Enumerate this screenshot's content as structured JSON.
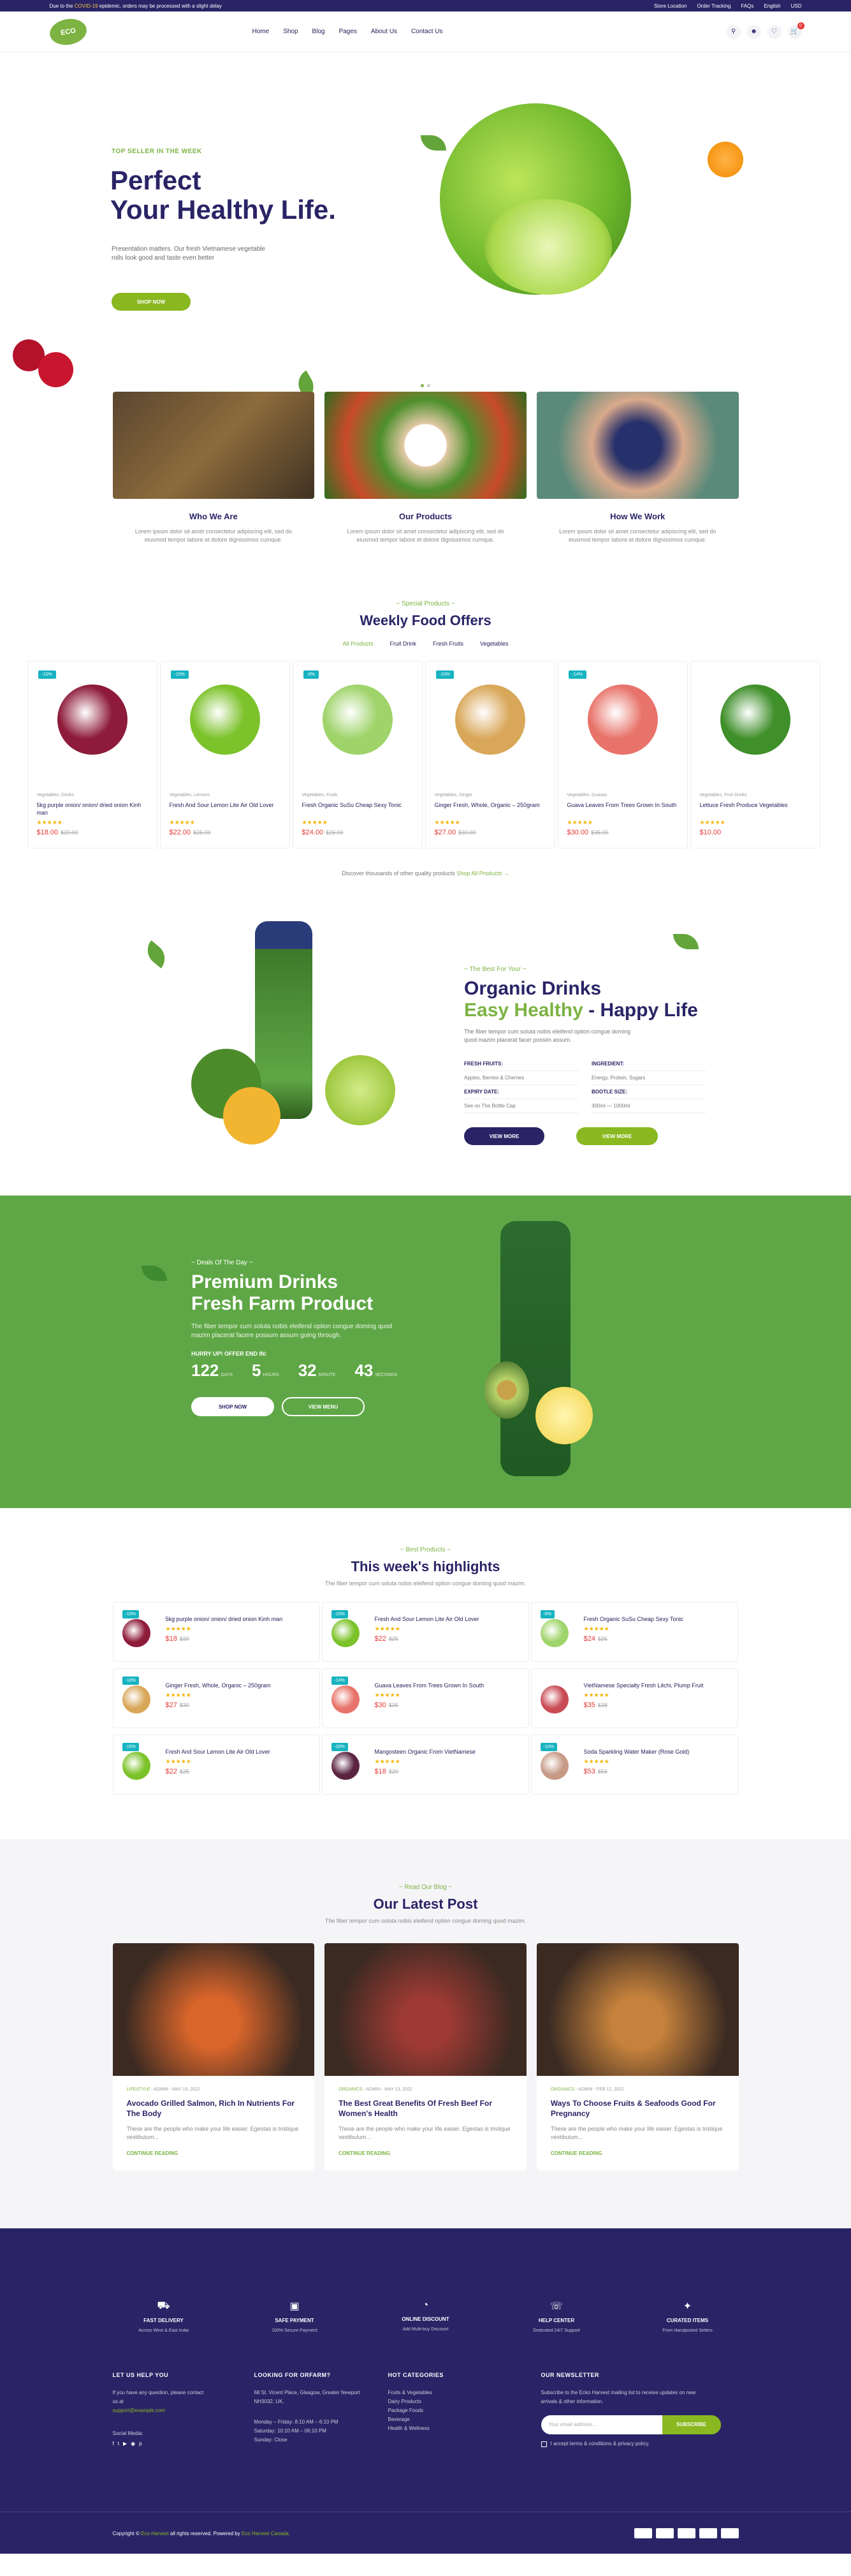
{
  "topbar": {
    "notice_pre": "Due to the ",
    "notice_hl": "COVID-19",
    "notice_post": " epidemic, orders may be processed with a slight delay",
    "links": [
      "Store Location",
      "Order Tracking",
      "FAQs",
      "English",
      "USD"
    ]
  },
  "header": {
    "logo": "ECO",
    "nav": [
      "Home",
      "Shop",
      "Blog",
      "Pages",
      "About Us",
      "Contact Us"
    ],
    "cart_count": "0"
  },
  "hero": {
    "eyebrow": "TOP SELLER IN THE WEEK",
    "title_line1": "Perfect",
    "title_line2": "Your Healthy Life.",
    "desc": "Presentation matters. Our fresh Vietnamese vegetable rolls look good and taste even better",
    "button": "SHOP NOW"
  },
  "about": [
    {
      "title": "Who We Are",
      "desc": "Lorem ipsum dolor sit amet consectetur adipiscing elit, sed do eiusmod tempor labore et dolore dignissimos cumque."
    },
    {
      "title": "Our Products",
      "desc": "Lorem ipsum dolor sit amet consectetur adipiscing elit, sed do eiusmod tempor labore et dolore dignissimos cumque."
    },
    {
      "title": "How We Work",
      "desc": "Lorem ipsum dolor sit amet consectetur adipiscing elit, sed do eiusmod tempor labore et dolore dignissimos cumque."
    }
  ],
  "offers": {
    "sub": "~ Special Products ~",
    "title": "Weekly Food Offers",
    "tabs": [
      "All Products",
      "Fruit Drink",
      "Fresh Fruits",
      "Vegetables"
    ],
    "products": [
      {
        "badge": "-10%",
        "cat": "Vegetables, Drinks",
        "name": "5kg purple onion/ onion/ dried onion Kinh man",
        "stars": "★★★★★",
        "price": "$18.00",
        "old": "$20.00",
        "color": "#8e1b3a"
      },
      {
        "badge": "-15%",
        "cat": "Vegetables, Lemons",
        "name": "Fresh And Sour Lemon Lite Air Old Lover",
        "stars": "★★★★★",
        "price": "$22.00",
        "old": "$25.00",
        "color": "#7cc22a"
      },
      {
        "badge": "-8%",
        "cat": "Vegetables, Fruits",
        "name": "Fresh Organic SuSu Cheap Sexy Tonic",
        "stars": "★★★★★",
        "price": "$24.00",
        "old": "$26.00",
        "color": "#9fd46b"
      },
      {
        "badge": "-10%",
        "cat": "Vegetables, Ginger",
        "name": "Ginger Fresh, Whole, Organic – 250gram",
        "stars": "★★★★★",
        "price": "$27.00",
        "old": "$30.00",
        "color": "#d9a75a"
      },
      {
        "badge": "-14%",
        "cat": "Vegetables, Guavas",
        "name": "Guava Leaves From Trees Grown In South",
        "stars": "★★★★★",
        "price": "$30.00",
        "old": "$35.00",
        "color": "#e8736a"
      },
      {
        "badge": "",
        "cat": "Vegetables, Fruit Drinks",
        "name": "Lettuce Fresh Produce Vegetables",
        "stars": "★★★★★",
        "price": "$10.00",
        "old": "",
        "color": "#3f8f2a"
      }
    ],
    "discover_pre": "Discover thousands of other quality products ",
    "discover_link": "Shop All Products →"
  },
  "organic": {
    "sub": "~ The Best For Your ~",
    "title_line1": "Organic Drinks",
    "title_green": "Easy Healthy",
    "title_rest": " - Happy Life",
    "desc": "The fiber tempor cum soluta nobis eleifend option congue doming quod mazim placerat facer possim assum.",
    "specs": [
      [
        "FRESH FRUITS:",
        "INGREDIENT:"
      ],
      [
        "Apples, Berries & Cherries",
        "Energy, Protein, Sugars"
      ],
      [
        "EXPIRY DATE:",
        "BOOTLE SIZE:"
      ],
      [
        "See on The Bottle Cap",
        "300ml — 1000ml"
      ]
    ],
    "btn1": "VIEW MORE",
    "btn2": "VIEW MORE"
  },
  "deals": {
    "sub": "~ Deals Of The Day ~",
    "title_line1": "Premium Drinks",
    "title_line2": "Fresh Farm Product",
    "desc": "The fiber tempor cum soluta nobis eleifend option congue doming quod mazim placerat facere possum assum going through.",
    "hurry": "HURRY UP! OFFER END IN:",
    "countdown": [
      {
        "n": "122",
        "l": "DAYS"
      },
      {
        "n": "5",
        "l": "HOURS"
      },
      {
        "n": "32",
        "l": "MINUTE"
      },
      {
        "n": "43",
        "l": "SECONDS"
      }
    ],
    "btn1": "SHOP NOW",
    "btn2": "VIEW MENU"
  },
  "highlights": {
    "sub": "~ Best Products ~",
    "title": "This week's highlights",
    "desc": "The fiber tempor cum soluta nobis eleifend option congue doming quod mazim.",
    "items": [
      {
        "badge": "-10%",
        "name": "5kg purple onion/ onion/ dried onion Kinh man",
        "price": "$18",
        "old": "$20",
        "color": "#8e1b3a"
      },
      {
        "badge": "-15%",
        "name": "Fresh And Sour Lemon Lite Air Old Lover",
        "price": "$22",
        "old": "$25",
        "color": "#7cc22a"
      },
      {
        "badge": "-8%",
        "name": "Fresh Organic SuSu Cheap Sexy Tonic",
        "price": "$24",
        "old": "$26",
        "color": "#9fd46b"
      },
      {
        "badge": "-10%",
        "name": "Ginger Fresh, Whole, Organic – 250gram",
        "price": "$27",
        "old": "$30",
        "color": "#d9a75a"
      },
      {
        "badge": "-14%",
        "name": "Guava Leaves From Trees Grown In South",
        "price": "$30",
        "old": "$35",
        "color": "#e8736a"
      },
      {
        "badge": "",
        "name": "VietNamese Specialty Fresh Litchi, Plump Fruit",
        "price": "$35",
        "old": "$38",
        "color": "#c94b55"
      },
      {
        "badge": "-15%",
        "name": "Fresh And Sour Lemon Lite Air Old Lover",
        "price": "$22",
        "old": "$25",
        "color": "#7cc22a"
      },
      {
        "badge": "-20%",
        "name": "Mangosteen Organic From VietNamese",
        "price": "$18",
        "old": "$20",
        "color": "#5a2340"
      },
      {
        "badge": "-10%",
        "name": "Soda Sparkling Water Maker (Rose Gold)",
        "price": "$53",
        "old": "$56",
        "color": "#c79a86"
      }
    ]
  },
  "blog": {
    "sub": "~ Read Our Blog ~",
    "title": "Our Latest Post",
    "desc": "The fiber tempor cum soluta nobis eleifend option congue doming quod mazim.",
    "posts": [
      {
        "cat": "LIFESTYLE",
        "meta": " - ADMIN - MAY 15, 2022",
        "title": "Avocado Grilled Salmon, Rich In Nutrients For The Body",
        "desc": "These are the people who make your life easier. Egestas is tristique vestibulum...",
        "more": "CONTINUE READING",
        "color": "#d9652b"
      },
      {
        "cat": "ORGANICS",
        "meta": " - ADMIN - MAY 13, 2022",
        "title": "The Best Great Benefits Of Fresh Beef For Women's Health",
        "desc": "These are the people who make your life easier. Egestas is tristique vestibulum...",
        "more": "CONTINUE READING",
        "color": "#9c3a33"
      },
      {
        "cat": "ORGANICS",
        "meta": " - ADMIN - FEB 12, 2022",
        "title": "Ways To Choose Fruits & Seafoods Good For Pregnancy",
        "desc": "These are the people who make your life easier. Egestas is tristique vestibulum...",
        "more": "CONTINUE READING",
        "color": "#c6823c"
      }
    ]
  },
  "footer": {
    "features": [
      {
        "title": "FAST DELIVERY",
        "desc": "Across West & East India"
      },
      {
        "title": "SAFE PAYMENT",
        "desc": "100% Secure Payment"
      },
      {
        "title": "ONLINE DISCOUNT",
        "desc": "Add Multi-buy Discount"
      },
      {
        "title": "HELP CENTER",
        "desc": "Dedicated 24/7 Support"
      },
      {
        "title": "CURATED ITEMS",
        "desc": "From Handpicked Sellers"
      }
    ],
    "help": {
      "title": "LET US HELP YOU",
      "text": "If you have any question, please contact us at",
      "email": "support@example.com",
      "social": "Social Media:"
    },
    "looking": {
      "title": "LOOKING FOR ORFARM?",
      "addr": "68 St. Vicent Place, Glasgow, Greater Newport NH3032, UK.",
      "h1": "Monday – Friday: 8:10 AM – 6:10 PM",
      "h2": "Saturday: 10:10 AM – 06:10 PM",
      "h3": "Sunday: Close"
    },
    "cats": {
      "title": "HOT CATEGORIES",
      "items": [
        "Fruits & Vegetables",
        "Dairy Products",
        "Package Foods",
        "Beverage",
        "Health & Wellness"
      ]
    },
    "news": {
      "title": "OUR NEWSLETTER",
      "text": "Subscribe to the Ecko Harvest mailing list to receive updates on new arrivals & other information.",
      "placeholder": "Your email address...",
      "button": "SUBSCRIBE",
      "agree": "I accept terms & conditions & privacy policy."
    },
    "copy_pre": "Copyright © ",
    "copy_brand": "Eco Harvest",
    "copy_mid": " all rights reserved. Powered by ",
    "copy_author": "Eco Harvest Canada."
  }
}
